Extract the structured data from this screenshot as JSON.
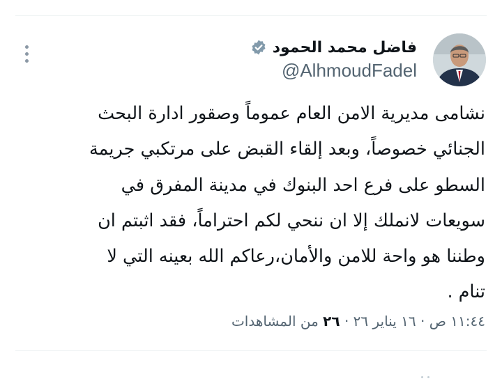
{
  "tweet": {
    "author": {
      "display_name": "فاضل محمد الحمود",
      "handle": "@AlhmoudFadel",
      "verified": true,
      "verified_icon": "verified-badge-icon",
      "verified_color": "#829aab"
    },
    "text": "نشامى مديرية الامن العام عموماً وصقور ادارة البحث\nالجنائي خصوصاً، وبعد إلقاء القبض على مرتكبي جريمة\nالسطو على فرع احد البنوك في مدينة المفرق في\nسويعات لانملك إلا ان ننحي لكم احتراماً، فقد اثبتم ان\nوطننا هو واحة للامن والأمان،رعاكم الله بعينه التي لا\nتنام .",
    "time": "١١:٤٤ ص",
    "date": "١٦ يناير ٢٦",
    "separator": "·",
    "views_count": "٢٦",
    "views_label": "من المشاهدات"
  },
  "icons": {
    "more": "more-options-icon"
  },
  "colors": {
    "text_primary": "#0f1419",
    "text_secondary": "#536471",
    "divider": "#eff3f4"
  }
}
